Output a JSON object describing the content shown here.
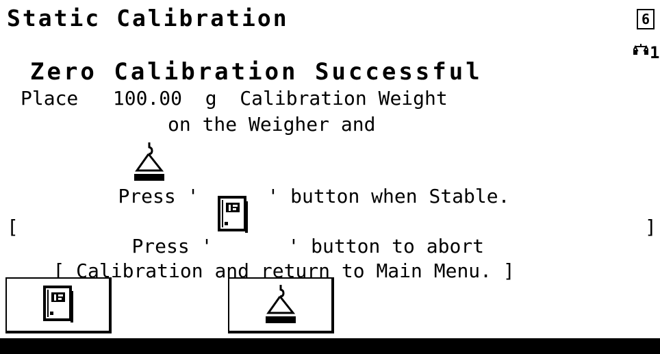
{
  "header": {
    "title": "Static Calibration",
    "page_badge": "6"
  },
  "scale_indicator": {
    "icon": "scale-icon",
    "number": "1"
  },
  "message": {
    "headline": "Zero Calibration Successful",
    "line1": "Place   100.00  g  Calibration Weight",
    "line2": "on the Weigher and",
    "line3_before": "Press '",
    "line3_after": "' button when Stable.",
    "line4_before": "Press '",
    "line4_after": "' button to abort",
    "line5": "Calibration and return to Main Menu.",
    "bracket_open": "[",
    "bracket_close": "]"
  },
  "softkeys": [
    {
      "icon": "abort-menu-icon"
    },
    {
      "icon": "weigh-hook-icon"
    }
  ]
}
